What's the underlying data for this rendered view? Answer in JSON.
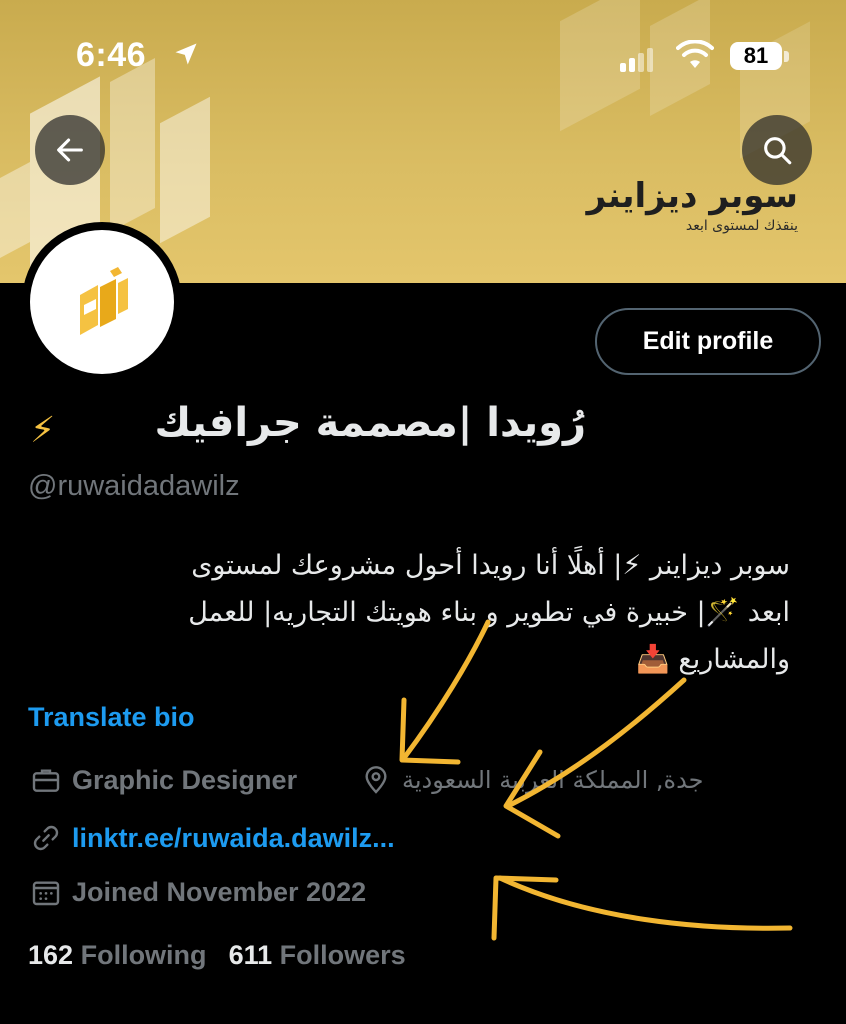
{
  "status_bar": {
    "time": "6:46",
    "battery": "81"
  },
  "header": {
    "back_icon": "arrow-left-icon",
    "search_icon": "search-icon"
  },
  "banner": {
    "brand_title": "سوبر ديزاينر",
    "brand_tagline": "ينقذك لمستوى ابعد",
    "accent_color": "#d9bc62"
  },
  "profile": {
    "edit_label": "Edit profile",
    "display_name": "رُويدا |مصممة جرافيك",
    "display_emoji": "⚡",
    "handle": "@ruwaidadawilz",
    "bio_lines": [
      "سوبر ديزاينر ⚡| أهلًا أنا رويدا أحول مشروعك لمستوى",
      "ابعد 🪄| خبيرة في تطوير و بناء هويتك التجاريه| للعمل",
      "والمشاريع 📥"
    ],
    "translate_label": "Translate bio",
    "profession": "Graphic Designer",
    "location": "جدة, المملكة العربية السعودية",
    "website": "linktr.ee/ruwaida.dawilz...",
    "joined": "Joined November 2022",
    "following_count": "162",
    "following_label": "Following",
    "followers_count": "611",
    "followers_label": "Followers"
  },
  "colors": {
    "link": "#1d9bf0",
    "muted": "#71767b",
    "annotation": "#f2b632"
  }
}
